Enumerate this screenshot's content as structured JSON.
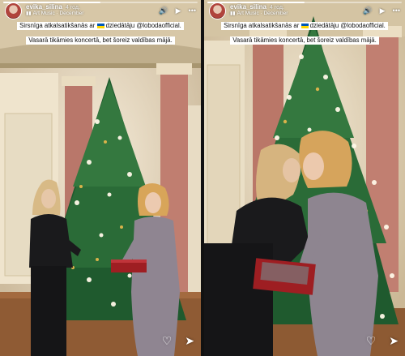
{
  "stories": [
    {
      "username": "evika_silina",
      "time_ago": "4 год.",
      "music_label": "Art Music · December",
      "caption": {
        "line1_before": "Sirsnīga atkalsatikšanās ar",
        "line1_after": "dziedātāju @lobodaofficial.",
        "line2": "Vasarā tikāmies koncertā, bet šoreiz valdības mājā."
      },
      "progress": 0.5,
      "header_icons": [
        "volume-icon",
        "play-icon",
        "more-icon"
      ],
      "footer_icons": [
        "heart-icon",
        "send-icon"
      ]
    },
    {
      "username": "evika_silina",
      "time_ago": "4 год.",
      "music_label": "Art Music · December",
      "caption": {
        "line1_before": "Sirsnīga atkalsatikšanās ar",
        "line1_after": "dziedātāju @lobodaofficial.",
        "line2": "Vasarā tikāmies koncertā, bet šoreiz valdības mājā."
      },
      "progress": 0.5,
      "header_icons": [
        "volume-icon",
        "play-icon",
        "more-icon"
      ],
      "footer_icons": [
        "heart-icon",
        "send-icon"
      ]
    }
  ]
}
